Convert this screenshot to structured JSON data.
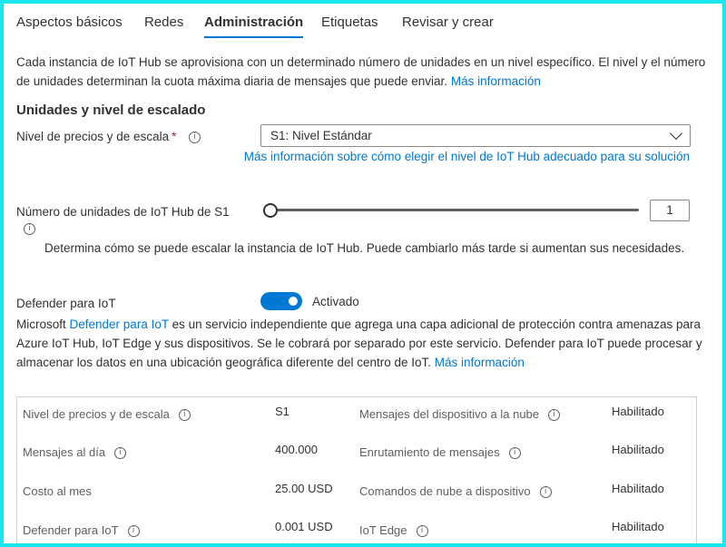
{
  "tabs": [
    {
      "label": "Aspectos básicos"
    },
    {
      "label": "Redes"
    },
    {
      "label": "Administración"
    },
    {
      "label": "Etiquetas"
    },
    {
      "label": "Revisar y crear"
    }
  ],
  "intro": {
    "text": "Cada instancia de IoT Hub se aprovisiona con un determinado número de unidades en un nivel específico. El nivel y el número de unidades determinan la cuota máxima diaria de mensajes que puede enviar.",
    "link": "Más información"
  },
  "scale": {
    "title": "Unidades y nivel de escalado",
    "tier_label": "Nivel de precios y de escala",
    "tier_required": "*",
    "tier_value": "S1: Nivel Estándar",
    "tier_help_link": "Más información sobre cómo elegir el nivel de IoT Hub adecuado para su solución",
    "units_label": "Número de unidades de IoT Hub de S1",
    "units_value": "1",
    "units_note": "Determina cómo se puede escalar la instancia de IoT Hub. Puede cambiarlo más tarde si aumentan sus necesidades."
  },
  "defender": {
    "label": "Defender para IoT",
    "toggle_text": "Activado",
    "desc_prefix": "Microsoft ",
    "desc_link": "Defender para IoT",
    "desc_body": " es un servicio independiente que agrega una capa adicional de protección contra amenazas para Azure IoT Hub, IoT Edge y sus dispositivos. Se le cobrará por separado por este servicio. Defender para IoT puede procesar y almacenar los datos en una ubicación geográfica diferente del centro de IoT. ",
    "desc_more": "Más información"
  },
  "summary": {
    "left": [
      {
        "label": "Nivel de precios y de escala",
        "value": "S1",
        "info": true
      },
      {
        "label": "Mensajes al día",
        "value": "400.000",
        "info": true
      },
      {
        "label": "Costo al mes",
        "value": "25.00 USD",
        "info": false
      },
      {
        "label": "Defender para IoT",
        "value": "0.001 USD",
        "info": true
      }
    ],
    "right": [
      {
        "label": "Mensajes del dispositivo a la nube",
        "value": "Habilitado",
        "info": true
      },
      {
        "label": "Enrutamiento de mensajes",
        "value": "Habilitado",
        "info": true
      },
      {
        "label": "Comandos de nube a dispositivo",
        "value": "Habilitado",
        "info": true
      },
      {
        "label": "IoT Edge",
        "value": "Habilitado",
        "info": true
      }
    ]
  },
  "colors": {
    "accent": "#0078d4",
    "frame": "#19e6ee"
  }
}
